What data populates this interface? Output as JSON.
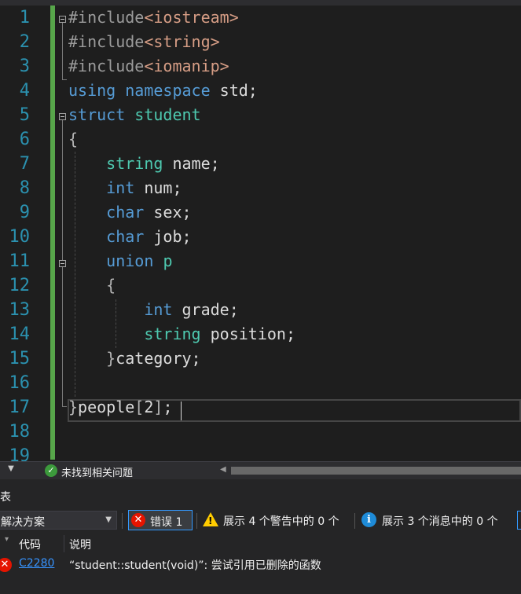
{
  "editor": {
    "line_numbers": [
      "1",
      "2",
      "3",
      "4",
      "5",
      "6",
      "7",
      "8",
      "9",
      "10",
      "11",
      "12",
      "13",
      "14",
      "15",
      "16",
      "17",
      "18",
      "19"
    ],
    "lines": [
      [
        {
          "t": "#include",
          "c": "inc"
        },
        {
          "t": "<iostream>",
          "c": "str"
        }
      ],
      [
        {
          "t": "#include",
          "c": "inc"
        },
        {
          "t": "<string>",
          "c": "str"
        }
      ],
      [
        {
          "t": "#include",
          "c": "inc"
        },
        {
          "t": "<iomanip>",
          "c": "str"
        }
      ],
      [
        {
          "t": "using",
          "c": "kw"
        },
        {
          "t": " ",
          "c": "plain"
        },
        {
          "t": "namespace",
          "c": "kw"
        },
        {
          "t": " std;",
          "c": "plain"
        }
      ],
      [
        {
          "t": "struct",
          "c": "kw"
        },
        {
          "t": " ",
          "c": "plain"
        },
        {
          "t": "student",
          "c": "ty"
        }
      ],
      [
        {
          "t": "{",
          "c": "br"
        }
      ],
      [
        {
          "t": "    ",
          "c": "plain"
        },
        {
          "t": "string",
          "c": "ty"
        },
        {
          "t": " name;",
          "c": "plain"
        }
      ],
      [
        {
          "t": "    ",
          "c": "plain"
        },
        {
          "t": "int",
          "c": "kw"
        },
        {
          "t": " num;",
          "c": "plain"
        }
      ],
      [
        {
          "t": "    ",
          "c": "plain"
        },
        {
          "t": "char",
          "c": "kw"
        },
        {
          "t": " sex;",
          "c": "plain"
        }
      ],
      [
        {
          "t": "    ",
          "c": "plain"
        },
        {
          "t": "char",
          "c": "kw"
        },
        {
          "t": " job;",
          "c": "plain"
        }
      ],
      [
        {
          "t": "    ",
          "c": "plain"
        },
        {
          "t": "union",
          "c": "kw"
        },
        {
          "t": " ",
          "c": "plain"
        },
        {
          "t": "p",
          "c": "ty"
        }
      ],
      [
        {
          "t": "    ",
          "c": "plain"
        },
        {
          "t": "{",
          "c": "br"
        }
      ],
      [
        {
          "t": "        ",
          "c": "plain"
        },
        {
          "t": "int",
          "c": "kw"
        },
        {
          "t": " grade;",
          "c": "plain"
        }
      ],
      [
        {
          "t": "        ",
          "c": "plain"
        },
        {
          "t": "string",
          "c": "ty"
        },
        {
          "t": " position;",
          "c": "plain"
        }
      ],
      [
        {
          "t": "    ",
          "c": "plain"
        },
        {
          "t": "}",
          "c": "br"
        },
        {
          "t": "category;",
          "c": "plain"
        }
      ],
      [
        {
          "t": "",
          "c": "plain"
        }
      ],
      [
        {
          "t": "}",
          "c": "br"
        },
        {
          "t": "people",
          "c": "plain"
        },
        {
          "t": "[",
          "c": "br"
        },
        {
          "t": "2",
          "c": "plain"
        },
        {
          "t": "]",
          "c": "br"
        },
        {
          "t": ";",
          "c": "plain"
        }
      ],
      [
        {
          "t": "",
          "c": "plain"
        }
      ],
      [
        {
          "t": "",
          "c": "plain"
        }
      ]
    ]
  },
  "statusbar": {
    "health_text": "未找到相关问题"
  },
  "error_list": {
    "title": "表",
    "scope_value": "解决方案",
    "errors_label": "错误 1",
    "warnings_label": "展示 4 个警告中的 0 个",
    "messages_label": "展示 3 个消息中的 0 个",
    "columns": {
      "code": "代码",
      "description": "说明"
    },
    "rows": [
      {
        "code": "C2280",
        "description": "“student::student(void)”: 尝试引用已删除的函数"
      }
    ]
  },
  "icons": {
    "error": "error-icon",
    "warning": "warning-icon",
    "info": "info-icon",
    "ok": "check-circle-icon"
  },
  "colors": {
    "keyword": "#569cd6",
    "type": "#4ec9b0",
    "string": "#d69d85",
    "line_number": "#2b91af",
    "change_bar": "#57a64a",
    "error": "#e51400"
  }
}
